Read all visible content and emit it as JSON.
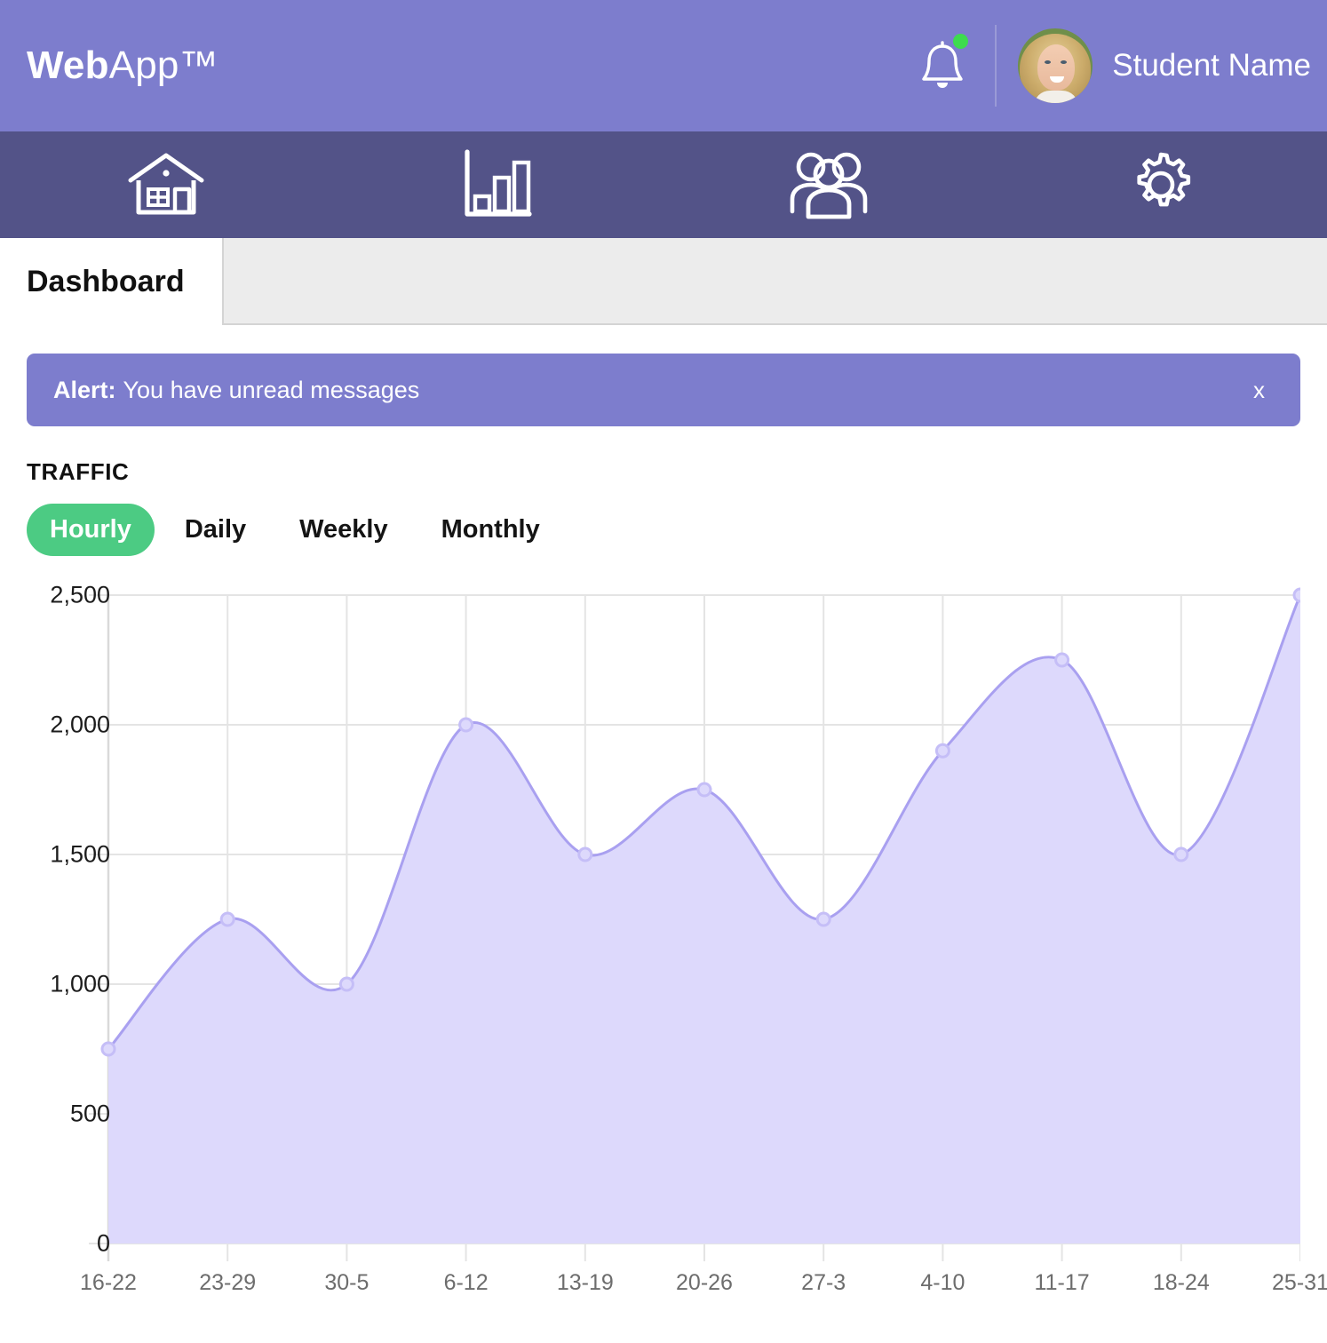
{
  "header": {
    "logo_bold": "Web",
    "logo_light": "App™",
    "notification_icon": "bell-icon",
    "has_notification_dot": true,
    "username": "Student Name",
    "bar_color": "#7d7dcd"
  },
  "nav": {
    "bar_color": "#535388",
    "items": [
      {
        "icon": "home-icon",
        "name": "nav-home"
      },
      {
        "icon": "bar-chart-icon",
        "name": "nav-analytics"
      },
      {
        "icon": "users-icon",
        "name": "nav-users"
      },
      {
        "icon": "gear-icon",
        "name": "nav-settings"
      }
    ]
  },
  "tabs": {
    "active_label": "Dashboard"
  },
  "alert": {
    "strong": "Alert:",
    "message": "You have unread messages",
    "close_label": "x",
    "background": "#7d7dcd"
  },
  "traffic": {
    "title": "TRAFFIC",
    "filters": [
      {
        "label": "Hourly",
        "active": true
      },
      {
        "label": "Daily",
        "active": false
      },
      {
        "label": "Weekly",
        "active": false
      },
      {
        "label": "Monthly",
        "active": false
      }
    ],
    "active_color": "#4ccb83"
  },
  "chart_data": {
    "type": "area",
    "title": "TRAFFIC",
    "xlabel": "",
    "ylabel": "",
    "categories": [
      "16-22",
      "23-29",
      "30-5",
      "6-12",
      "13-19",
      "20-26",
      "27-3",
      "4-10",
      "11-17",
      "18-24",
      "25-31"
    ],
    "values": [
      750,
      1250,
      1000,
      2000,
      1500,
      1750,
      1250,
      1900,
      2250,
      1500,
      2500
    ],
    "ytick_labels": [
      "0",
      "500",
      "1,000",
      "1,500",
      "2,000",
      "2,500"
    ],
    "ytick_values": [
      0,
      500,
      1000,
      1500,
      2000,
      2500
    ],
    "ylim": [
      0,
      2500
    ],
    "grid": true,
    "legend": "none",
    "smoothing": "spline",
    "line_color": "#a9a0f0",
    "fill_color": "#ddd9fc",
    "point_color": "#c5bef7"
  }
}
